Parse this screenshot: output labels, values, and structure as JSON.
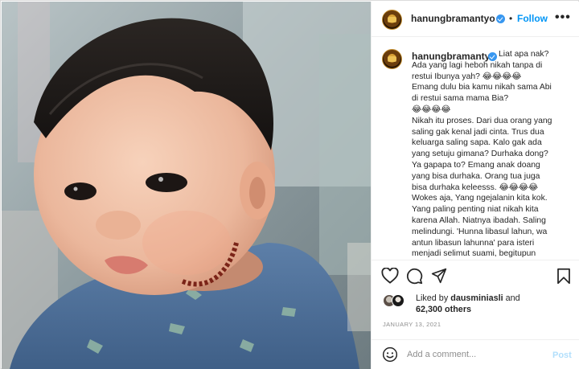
{
  "post": {
    "username": "hanungbramantyo",
    "verified": true,
    "dot": "•",
    "follow_label": "Follow",
    "more_label": "•••",
    "photo_subject": "baby in blue shirt with beaded necklace"
  },
  "caption": {
    "username": "hanungbramantyo",
    "lines": [
      "Liat apa nak?",
      "Ada yang lagi heboh nikah tanpa di",
      "restui Ibunya yah? 😂😂😂😂",
      "Emang dulu bia kamu nikah sama Abi",
      "di restui sama mama Bia?",
      "😂😂😂😂",
      "Nikah itu proses. Dari dua orang yang",
      "saling gak kenal jadi cinta. Trus dua",
      "keluarga saling sapa. Kalo gak ada",
      "yang setuju gimana? Durhaka dong?",
      "Ya gapapa to? Emang anak doang",
      "yang bisa durhaka. Orang tua juga",
      "bisa durhaka keleesss. 😂😂😂😂",
      "Wokes aja, Yang ngejalanin kita kok.",
      "Yang paling penting niat nikah kita",
      "karena Allah. Niatnya ibadah. Saling",
      "melindungi. 'Hunna libasul lahun, wa",
      "antun libasun lahunna' para isteri",
      "menjadi selimut suami, begitupun"
    ]
  },
  "actions": {
    "icons": [
      "heart-icon",
      "comment-icon",
      "share-icon",
      "bookmark-icon"
    ]
  },
  "likes": {
    "prefix": "Liked by ",
    "user": "dausminiasli",
    "suffix": " and",
    "count": "62,300 others"
  },
  "date": "JANUARY 13, 2021",
  "comment": {
    "placeholder": "Add a comment...",
    "post_label": "Post"
  },
  "colors": {
    "accent": "#0095f6",
    "post_disabled": "#b2dffc",
    "verified": "#3897f0",
    "muted": "#8e8e8e"
  }
}
